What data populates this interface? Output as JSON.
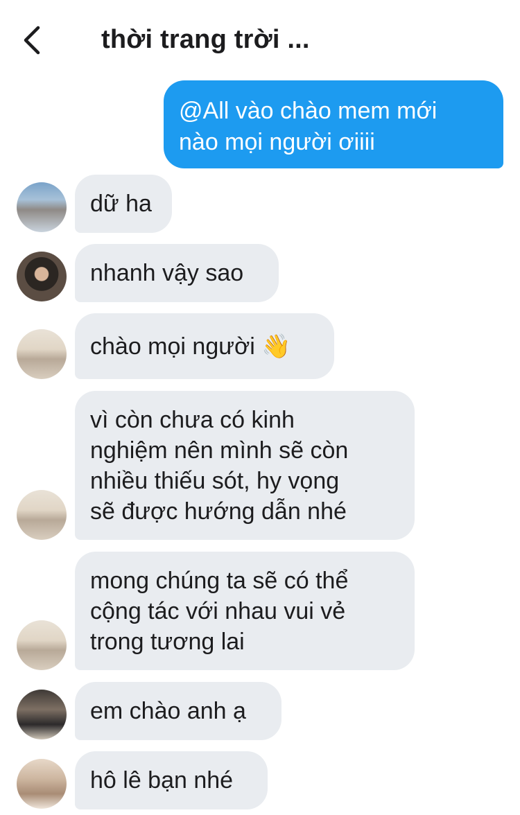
{
  "header": {
    "back_icon": "chevron-left-icon",
    "title": "thời trang trời ..."
  },
  "outgoing": {
    "lines": [
      "@All vào chào mem mới",
      "nào mọi người ơiiii"
    ]
  },
  "messages": [
    {
      "avatar": "avatar-1",
      "lines": [
        "dữ ha"
      ]
    },
    {
      "avatar": "avatar-2",
      "lines": [
        "nhanh vậy sao"
      ]
    },
    {
      "avatar": "avatar-3",
      "lines": [
        "chào mọi người 👋"
      ]
    },
    {
      "avatar": "avatar-3",
      "lines": [
        "vì còn chưa có kinh",
        "nghiệm nên mình sẽ còn",
        "nhiều thiếu sót, hy vọng",
        "sẽ được hướng dẫn nhé"
      ]
    },
    {
      "avatar": "avatar-3",
      "lines": [
        "mong chúng ta sẽ có thể",
        "cộng tác với nhau vui vẻ",
        "trong tương lai"
      ]
    },
    {
      "avatar": "avatar-4",
      "lines": [
        "em chào anh ạ"
      ]
    },
    {
      "avatar": "avatar-5",
      "lines": [
        "hô lê bạn nhé"
      ]
    }
  ],
  "colors": {
    "outgoing_bubble": "#1d9bf0",
    "incoming_bubble": "#e9ecf0",
    "text": "#1c1c1e"
  }
}
